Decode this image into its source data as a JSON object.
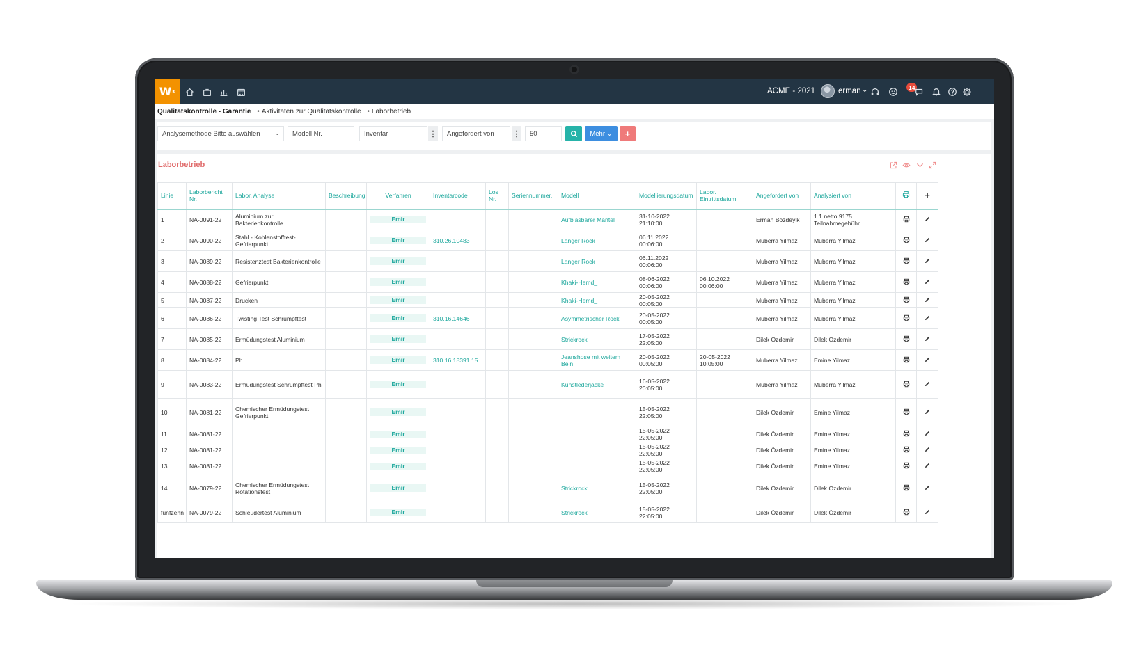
{
  "topbar": {
    "logo": "W",
    "logo_sup": "3",
    "company": "ACME - 2021",
    "username": "erman",
    "notification_count": "14",
    "nav_icons": [
      "home-icon",
      "briefcase-icon",
      "chart-icon",
      "calendar-icon"
    ],
    "right_icons": [
      "headset-icon",
      "smiley-icon",
      "chat-icon",
      "bell-icon",
      "help-icon",
      "gear-icon"
    ]
  },
  "breadcrumb": {
    "root": "Qualitätskontrolle - Garantie",
    "items": [
      "Aktivitäten zur Qualitätskontrolle",
      "Laborbetrieb"
    ]
  },
  "filters": {
    "analysis_method": "Analysemethode Bitte auswählen",
    "model_no": "Modell Nr.",
    "inventory": "Inventar",
    "requested_by": "Angefordert von",
    "page_size": "50",
    "more_label": "Mehr",
    "add_label": "+"
  },
  "panel": {
    "title": "Laborbetrieb"
  },
  "table": {
    "columns": {
      "linie": "Linie",
      "laborbericht": "Laborbericht Nr.",
      "analyse": "Labor. Analyse",
      "beschreibung": "Beschreibung",
      "verfahren": "Verfahren",
      "inventarcode": "Inventarcode",
      "los": "Los Nr.",
      "seriennummer": "Seriennummer.",
      "modell": "Modell",
      "modelldatum": "Modellierungsdatum",
      "eintrittsdatum": "Labor. Eintrittsdatum",
      "angefordert": "Angefordert von",
      "analysiert": "Analysiert von"
    },
    "rows": [
      {
        "linie": "1",
        "nr": "NA-0091-22",
        "analyse": "Aluminium zur Bakterienkontrolle",
        "verfahren": "Emir",
        "inventar": "",
        "modell": "Aufblasbarer Mantel",
        "datum": "31-10-2022 21:10:00",
        "eintritt": "",
        "angefordert": "Erman Bozdeyik",
        "analysiert": "1 1 netto 9175 Teilnahmegebühr"
      },
      {
        "linie": "2",
        "nr": "NA-0090-22",
        "analyse": "Stahl - Kohlenstofftest-Gefrierpunkt",
        "verfahren": "Emir",
        "inventar": "310.26.10483",
        "modell": "Langer Rock",
        "datum": "06.11.2022 00:06:00",
        "eintritt": "",
        "angefordert": "Muberra Yilmaz",
        "analysiert": "Muberra Yilmaz"
      },
      {
        "linie": "3",
        "nr": "NA-0089-22",
        "analyse": "Resistenztest Bakterienkontrolle",
        "verfahren": "Emir",
        "inventar": "",
        "modell": "Langer Rock",
        "datum": "06.11.2022 00:06:00",
        "eintritt": "",
        "angefordert": "Muberra Yilmaz",
        "analysiert": "Muberra Yilmaz"
      },
      {
        "linie": "4",
        "nr": "NA-0088-22",
        "analyse": "Gefrierpunkt",
        "verfahren": "Emir",
        "inventar": "",
        "modell": "Khaki-Hemd_",
        "datum": "08-06-2022 00:06:00",
        "eintritt": "06.10.2022 00:06:00",
        "angefordert": "Muberra Yilmaz",
        "analysiert": "Muberra Yilmaz"
      },
      {
        "linie": "5",
        "nr": "NA-0087-22",
        "analyse": "Drucken",
        "verfahren": "Emir",
        "inventar": "",
        "modell": "Khaki-Hemd_",
        "datum": "20-05-2022 00:05:00",
        "eintritt": "",
        "angefordert": "Muberra Yilmaz",
        "analysiert": "Muberra Yilmaz"
      },
      {
        "linie": "6",
        "nr": "NA-0086-22",
        "analyse": "Twisting Test Schrumpftest",
        "verfahren": "Emir",
        "inventar": "310.16.14646",
        "modell": "Asymmetrischer Rock",
        "datum": "20-05-2022 00:05:00",
        "eintritt": "",
        "angefordert": "Muberra Yilmaz",
        "analysiert": "Muberra Yilmaz"
      },
      {
        "linie": "7",
        "nr": "NA-0085-22",
        "analyse": "Ermüdungstest Aluminium",
        "verfahren": "Emir",
        "inventar": "",
        "modell": "Strickrock",
        "datum": "17-05-2022 22:05:00",
        "eintritt": "",
        "angefordert": "Dilek Özdemir",
        "analysiert": "Dilek Özdemir"
      },
      {
        "linie": "8",
        "nr": "NA-0084-22",
        "analyse": "Ph",
        "verfahren": "Emir",
        "inventar": "310.16.18391.15",
        "modell": "Jeanshose mit weitem Bein",
        "datum": "20-05-2022 00:05:00",
        "eintritt": "20-05-2022 10:05:00",
        "angefordert": "Muberra Yilmaz",
        "analysiert": "Emine Yilmaz"
      },
      {
        "linie": "9",
        "nr": "NA-0083-22",
        "analyse": "Ermüdungstest Schrumpftest Ph",
        "verfahren": "Emir",
        "inventar": "",
        "modell": "Kunstlederjacke",
        "datum": "16-05-2022 20:05:00",
        "eintritt": "",
        "angefordert": "Muberra Yilmaz",
        "analysiert": "Muberra Yilmaz"
      },
      {
        "linie": "10",
        "nr": "NA-0081-22",
        "analyse": "Chemischer Ermüdungstest Gefrierpunkt",
        "verfahren": "Emir",
        "inventar": "",
        "modell": "",
        "datum": "15-05-2022 22:05:00",
        "eintritt": "",
        "angefordert": "Dilek Özdemir",
        "analysiert": "Emine Yilmaz"
      },
      {
        "linie": "11",
        "nr": "NA-0081-22",
        "analyse": "",
        "verfahren": "Emir",
        "inventar": "",
        "modell": "",
        "datum": "15-05-2022 22:05:00",
        "eintritt": "",
        "angefordert": "Dilek Özdemir",
        "analysiert": "Emine Yilmaz"
      },
      {
        "linie": "12",
        "nr": "NA-0081-22",
        "analyse": "",
        "verfahren": "Emir",
        "inventar": "",
        "modell": "",
        "datum": "15-05-2022 22:05:00",
        "eintritt": "",
        "angefordert": "Dilek Özdemir",
        "analysiert": "Emine Yilmaz"
      },
      {
        "linie": "13",
        "nr": "NA-0081-22",
        "analyse": "",
        "verfahren": "Emir",
        "inventar": "",
        "modell": "",
        "datum": "15-05-2022 22:05:00",
        "eintritt": "",
        "angefordert": "Dilek Özdemir",
        "analysiert": "Emine Yilmaz"
      },
      {
        "linie": "14",
        "nr": "NA-0079-22",
        "analyse": "Chemischer Ermüdungstest Rotationstest",
        "verfahren": "Emir",
        "inventar": "",
        "modell": "Strickrock",
        "datum": "15-05-2022 22:05:00",
        "eintritt": "",
        "angefordert": "Dilek Özdemir",
        "analysiert": "Dilek Özdemir"
      },
      {
        "linie": "fünfzehn",
        "nr": "NA-0079-22",
        "analyse": "Schleudertest Aluminium",
        "verfahren": "Emir",
        "inventar": "",
        "modell": "Strickrock",
        "datum": "15-05-2022 22:05:00",
        "eintritt": "",
        "angefordert": "Dilek Özdemir",
        "analysiert": "Dilek Özdemir"
      }
    ]
  },
  "colors": {
    "topbar": "#233544",
    "logo": "#f39200",
    "accent_teal": "#1ca79c",
    "panel_title": "#e06b6b",
    "search_button": "#26b3a9",
    "more_button": "#3d8ee0",
    "add_button": "#ef7a7a",
    "badge": "#e74c3c"
  }
}
